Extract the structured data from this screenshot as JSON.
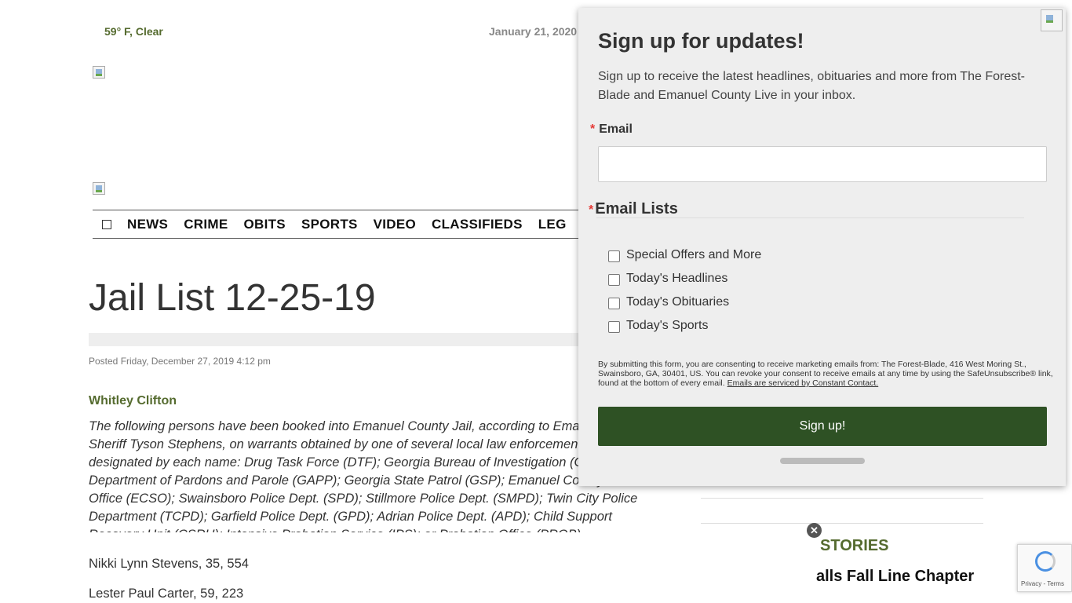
{
  "header": {
    "weather": "59° F, Clear",
    "date": "January 21, 2020"
  },
  "nav": {
    "items": [
      "NEWS",
      "CRIME",
      "OBITS",
      "SPORTS",
      "VIDEO",
      "CLASSIFIEDS",
      "LEG"
    ]
  },
  "article": {
    "title": "Jail List 12-25-19",
    "posted": "Posted Friday, December 27, 2019 4:12 pm",
    "author": "Whitley Clifton",
    "intro": "The following persons have been booked into Emanuel County Jail, according to Emanuel County Sheriff Tyson Stephens, on warrants obtained by one of several local law enforcement agencies designated by each name: Drug Task Force (DTF); Georgia Bureau of Investigation (GBI); Georgia Department of Pardons and Parole (GAPP); Georgia State Patrol (GSP); Emanuel County Sheriff's Office (ECSO); Swainsboro Police Dept. (SPD); Stillmore Police Dept. (SMPD); Twin City Police Department (TCPD); Garfield Police Dept. (GPD); Adrian Police Dept. (APD); Child Support Recovery Unit (CSRU); Intensive Probation Service (IPS); or Probation Office (PROB).",
    "entries": [
      "Nikki Lynn Stevens, 35, 554",
      "Lester Paul Carter, 59, 223"
    ]
  },
  "sidebar": {
    "heading": "STORIES",
    "story": "alls Fall Line Chapter",
    "close_symbol": "✕"
  },
  "recaptcha": {
    "links": "Privacy - Terms"
  },
  "modal": {
    "title": "Sign up for updates!",
    "description": "Sign up to receive the latest headlines, obituaries and more from The Forest-Blade and Emanuel County Live in your inbox.",
    "required_mark": "*",
    "email_label": "Email",
    "email_value": "",
    "lists_label": "Email Lists",
    "lists": [
      "Special Offers and More",
      "Today's Headlines",
      "Today's Obituaries",
      "Today's Sports"
    ],
    "consent": "By submitting this form, you are consenting to receive marketing emails from: The Forest-Blade, 416 West Moring St., Swainsboro, GA, 30401, US. You can revoke your consent to receive emails at any time by using the SafeUnsubscribe® link, found at the bottom of every email.",
    "consent_link": "Emails are serviced by Constant Contact.",
    "submit_label": "Sign up!"
  },
  "colors": {
    "accent_green": "#556b2f",
    "button_green": "#2e5124",
    "required_red": "#e53935"
  }
}
